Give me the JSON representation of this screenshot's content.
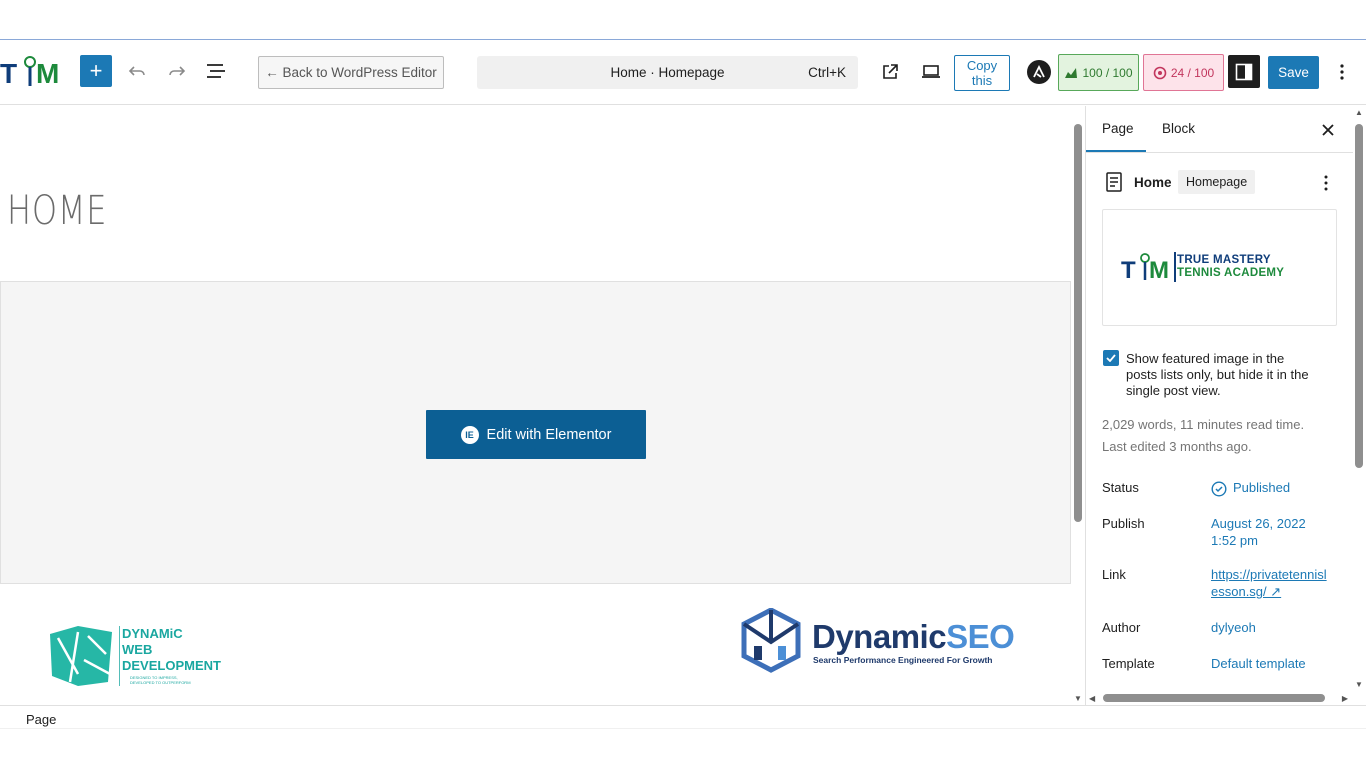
{
  "toolbar": {
    "add_block_label": "+",
    "back_label": "← Back to WordPress Editor",
    "command_title": "Home · Homepage",
    "command_shortcut": "Ctrl+K",
    "copy_line1": "Copy",
    "copy_line2": "this",
    "seo_score": "100 / 100",
    "readability_score": "24 / 100",
    "save_label": "Save",
    "site_logo_text": "TM"
  },
  "canvas": {
    "page_heading": "HOME",
    "elementor_button_label": "Edit with Elementor",
    "footer_left_logo": {
      "line1": "DYNAMiC",
      "line2": "WEB",
      "line3": "DEVELOPMENT",
      "tagline1": "DESIGNED TO IMPRESS,",
      "tagline2": "DEVELOPED TO OUTPERFORM"
    },
    "footer_right_logo": {
      "name_part1": "Dynamic",
      "name_part2": "SEO",
      "tagline": "Search Performance Engineered For Growth"
    }
  },
  "sidebar": {
    "tabs": [
      {
        "label": "Page"
      },
      {
        "label": "Block"
      }
    ],
    "document": {
      "title": "Home",
      "badge": "Homepage"
    },
    "featured_image": {
      "mark": "TM",
      "line1": "TRUE MASTERY",
      "line2": "TENNIS ACADEMY"
    },
    "featured_checkbox_label": "Show featured image in the posts lists only, but hide it in the single post view.",
    "word_count": "2,029 words, 11 minutes read time.",
    "last_edited": "Last edited 3 months ago.",
    "properties": [
      {
        "label": "Status",
        "value": "Published"
      },
      {
        "label": "Publish",
        "value": "August 26, 2022 1:52 pm"
      },
      {
        "label": "Link",
        "value": "https://privatetennislesson.sg/ ↗"
      },
      {
        "label": "Author",
        "value": "dylyeoh"
      },
      {
        "label": "Template",
        "value": "Default template"
      }
    ]
  },
  "statusbar": {
    "label": "Page"
  },
  "colors": {
    "accent": "#1c79b5",
    "elementor_button": "#0c5f94",
    "seo_good": "#58a85a",
    "readability_bad": "#e07595"
  }
}
